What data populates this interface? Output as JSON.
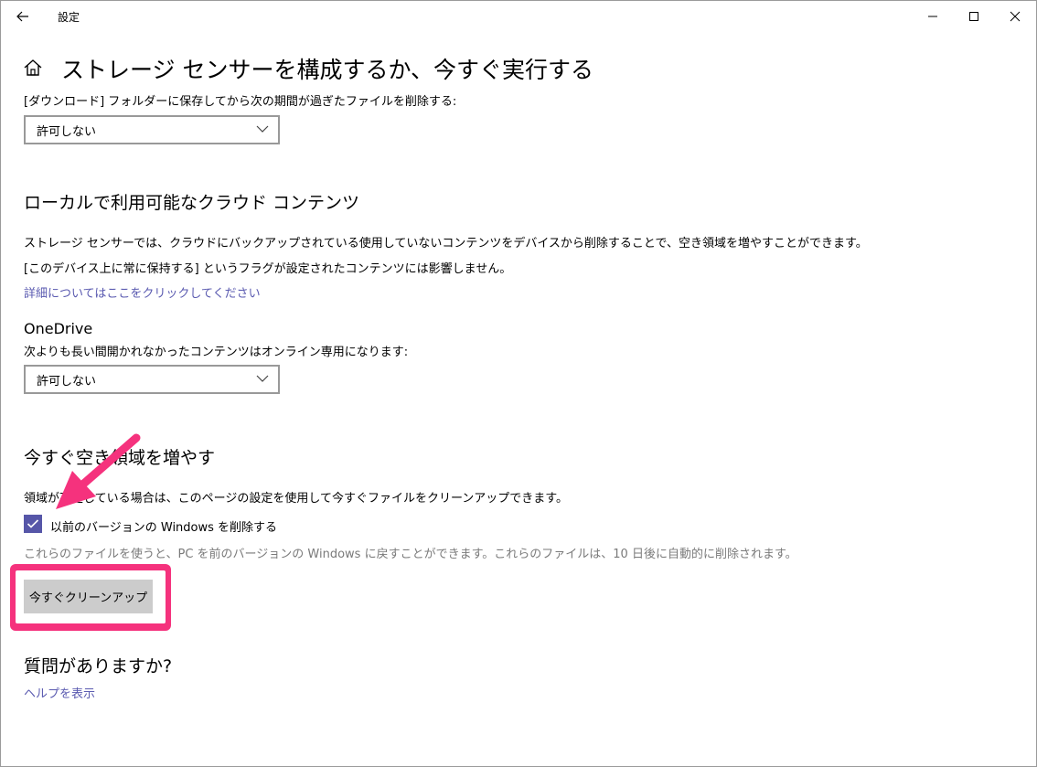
{
  "window": {
    "app_title": "設定",
    "controls": [
      "minimize",
      "maximize",
      "close"
    ]
  },
  "header": {
    "title": "ストレージ センサーを構成するか、今すぐ実行する",
    "home_icon": "home-icon",
    "back_icon": "back-arrow-icon"
  },
  "downloads": {
    "label": "[ダウンロード] フォルダーに保存してから次の期間が過ぎたファイルを削除する:",
    "selected": "許可しない"
  },
  "cloud": {
    "title": "ローカルで利用可能なクラウド コンテンツ",
    "desc1": "ストレージ センサーでは、クラウドにバックアップされている使用していないコンテンツをデバイスから削除することで、空き領域を増やすことができます。",
    "desc2": "[このデバイス上に常に保持する] というフラグが設定されたコンテンツには影響しません。",
    "link": "詳細についてはここをクリックしてください"
  },
  "onedrive": {
    "title": "OneDrive",
    "label": "次よりも長い間開かれなかったコンテンツはオンライン専用になります:",
    "selected": "許可しない"
  },
  "free_space": {
    "title": "今すぐ空き領域を増やす",
    "desc": "領域が不足している場合は、このページの設定を使用して今すぐファイルをクリーンアップできます。",
    "checkbox_label": "以前のバージョンの Windows を削除する",
    "checkbox_checked": true,
    "note": "これらのファイルを使うと、PC を前のバージョンの Windows に戻すことができます。これらのファイルは、10 日後に自動的に削除されます。",
    "button_label": "今すぐクリーンアップ"
  },
  "help": {
    "title": "質問がありますか?",
    "link": "ヘルプを表示"
  },
  "colors": {
    "accent": "#5656a8",
    "link": "#5a5ab0",
    "annotation": "#f5327d",
    "button_bg": "#cccccc",
    "muted_text": "#7a7a7a"
  }
}
